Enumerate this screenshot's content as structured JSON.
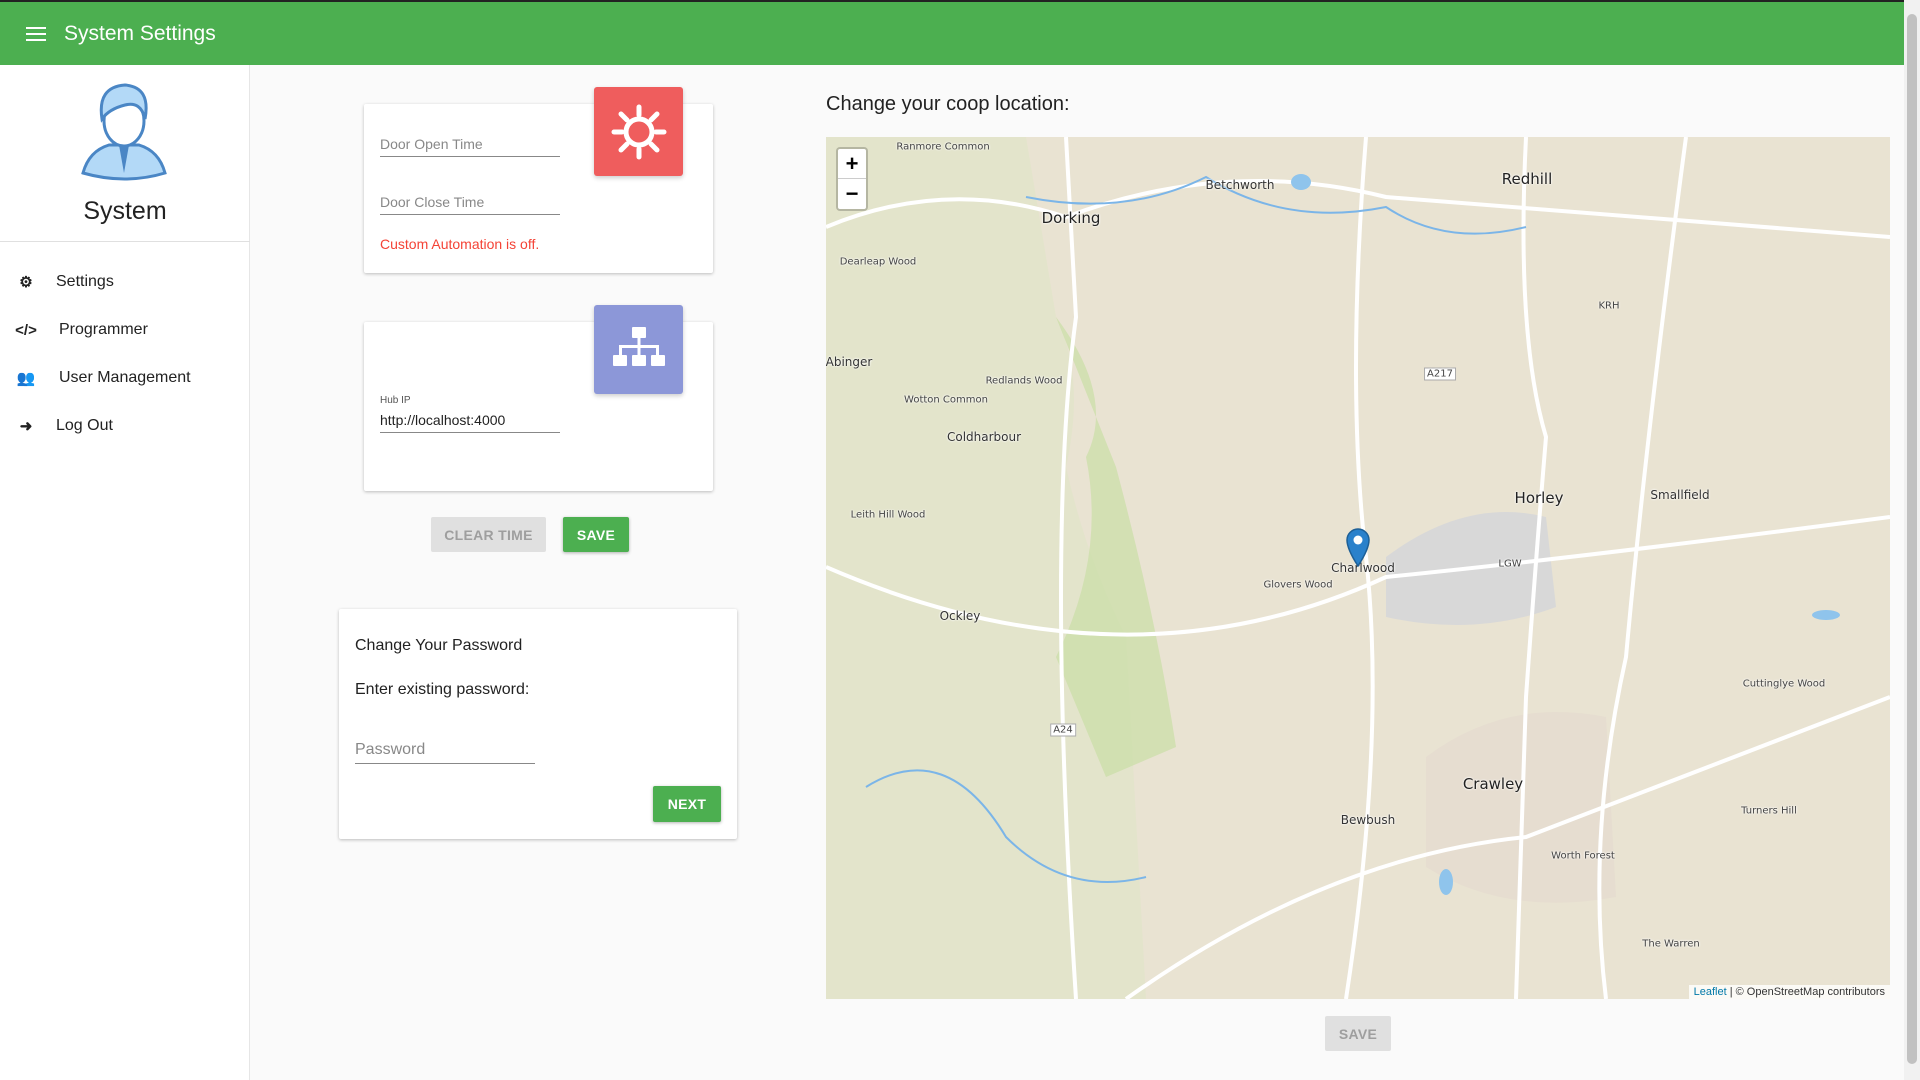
{
  "header": {
    "title": "System Settings",
    "menu_icon": "hamburger-icon"
  },
  "sidebar": {
    "user_name": "System",
    "items": [
      {
        "label": "Settings",
        "icon": "gear-icon"
      },
      {
        "label": "Programmer",
        "icon": "code-icon"
      },
      {
        "label": "User Management",
        "icon": "users-icon"
      },
      {
        "label": "Log Out",
        "icon": "sign-out-icon"
      }
    ]
  },
  "door_card": {
    "open_placeholder": "Door Open Time",
    "close_placeholder": "Door Close Time",
    "status": "Custom Automation is off.",
    "status_color": "#f44336",
    "icon": "sun-icon",
    "icon_color": "#ef5350"
  },
  "hub_card": {
    "label": "Hub IP",
    "value": "http://localhost:4000",
    "icon": "sitemap-icon",
    "icon_color": "#7986cb"
  },
  "actions": {
    "clear_time": "CLEAR TIME",
    "save": "SAVE"
  },
  "password_card": {
    "title": "Change Your Password",
    "prompt": "Enter existing password:",
    "placeholder": "Password",
    "next": "NEXT"
  },
  "map_section": {
    "title": "Change your coop location:",
    "save": "SAVE",
    "zoom_in": "+",
    "zoom_out": "−",
    "attribution_link": "Leaflet",
    "attribution_text": " | © OpenStreetMap contributors",
    "places": [
      "Dorking",
      "Betchworth",
      "Redhill",
      "Horley",
      "Charlwood",
      "Crawley",
      "Smallfield",
      "Coldharbour",
      "Ockley",
      "Bewbush",
      "Abinger",
      "Glovers Wood",
      "Leith Hill Wood",
      "Redlands Wood",
      "Worth Forest",
      "Turners Hill",
      "Cuttinglye Wood",
      "The Warren",
      "LGW",
      "KRH",
      "Dearleap Wood",
      "Wotton Common",
      "Ranmore Common",
      "A217",
      "A24"
    ]
  },
  "colors": {
    "primary": "#4caf50",
    "disabled": "#e0e0e0"
  }
}
